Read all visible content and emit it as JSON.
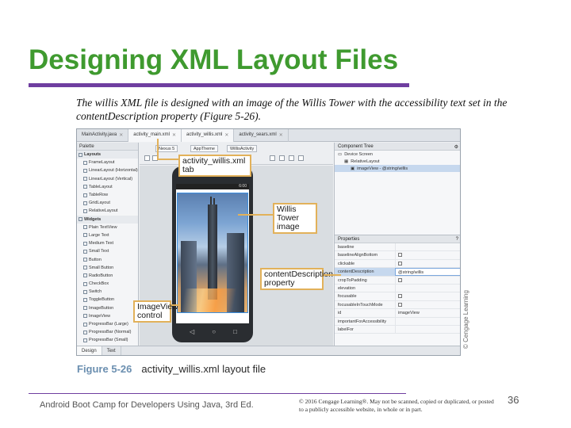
{
  "slide": {
    "title": "Designing XML Layout Files",
    "caption": "The willis XML file is designed with an image of the Willis Tower with the accessibility text set in the contentDescription property (Figure 5-26).",
    "figure_number": "Figure 5-26",
    "figure_caption": "activity_willis.xml layout file"
  },
  "ide": {
    "tabs": [
      "MainActivity.java",
      "activity_main.xml",
      "activity_willis.xml",
      "activity_sears.xml"
    ],
    "palette": {
      "header": "Palette",
      "items": [
        {
          "label": "Layouts",
          "group": true
        },
        {
          "label": "FrameLayout"
        },
        {
          "label": "LinearLayout (Horizontal)"
        },
        {
          "label": "LinearLayout (Vertical)"
        },
        {
          "label": "TableLayout"
        },
        {
          "label": "TableRow"
        },
        {
          "label": "GridLayout"
        },
        {
          "label": "RelativeLayout"
        },
        {
          "label": "Widgets",
          "group": true
        },
        {
          "label": "Plain TextView"
        },
        {
          "label": "Large Text"
        },
        {
          "label": "Medium Text"
        },
        {
          "label": "Small Text"
        },
        {
          "label": "Button"
        },
        {
          "label": "Small Button"
        },
        {
          "label": "RadioButton"
        },
        {
          "label": "CheckBox"
        },
        {
          "label": "Switch"
        },
        {
          "label": "ToggleButton"
        },
        {
          "label": "ImageButton"
        },
        {
          "label": "ImageView"
        },
        {
          "label": "ProgressBar (Large)"
        },
        {
          "label": "ProgressBar (Normal)"
        },
        {
          "label": "ProgressBar (Small)"
        },
        {
          "label": "ProgressBar (Horizontal)"
        }
      ]
    },
    "toolbar": {
      "device": "Nexus 5",
      "theme": "AppTheme",
      "activity": "WillisActivity"
    },
    "status_time": "6:00",
    "component_tree": {
      "header": "Component Tree",
      "rows": [
        "Device Screen",
        "RelativeLayout",
        "imageView - @string/willis"
      ]
    },
    "properties": {
      "header": "Properties",
      "rows": [
        {
          "name": "baseline",
          "value": ""
        },
        {
          "name": "baselineAlignBottom",
          "value": "checkbox"
        },
        {
          "name": "clickable",
          "value": "checkbox"
        },
        {
          "name": "contentDescription",
          "value": "@string/willis",
          "selected": true
        },
        {
          "name": "cropToPadding",
          "value": "checkbox"
        },
        {
          "name": "elevation",
          "value": ""
        },
        {
          "name": "focusable",
          "value": "checkbox"
        },
        {
          "name": "focusableInTouchMode",
          "value": "checkbox"
        },
        {
          "name": "id",
          "value": "imageView"
        },
        {
          "name": "importantForAccessibility",
          "value": ""
        },
        {
          "name": "labelFor",
          "value": ""
        }
      ]
    },
    "bottom_tabs": [
      "Design",
      "Text"
    ],
    "watermark": "© Cengage Learning"
  },
  "callouts": {
    "tab": "activity_willis.xml tab",
    "image_line1": "Willis Tower",
    "image_line2": "image",
    "content_line1": "contentDescription",
    "content_line2": "property",
    "imageview_line1": "ImageView",
    "imageview_line2": "control"
  },
  "footer": {
    "course": "Android Boot Camp for Developers Using Java, 3rd Ed.",
    "copyright": "© 2016 Cengage Learning®. May not be scanned, copied or duplicated, or posted to a publicly accessible website, in whole or in part.",
    "page_number": "36"
  }
}
